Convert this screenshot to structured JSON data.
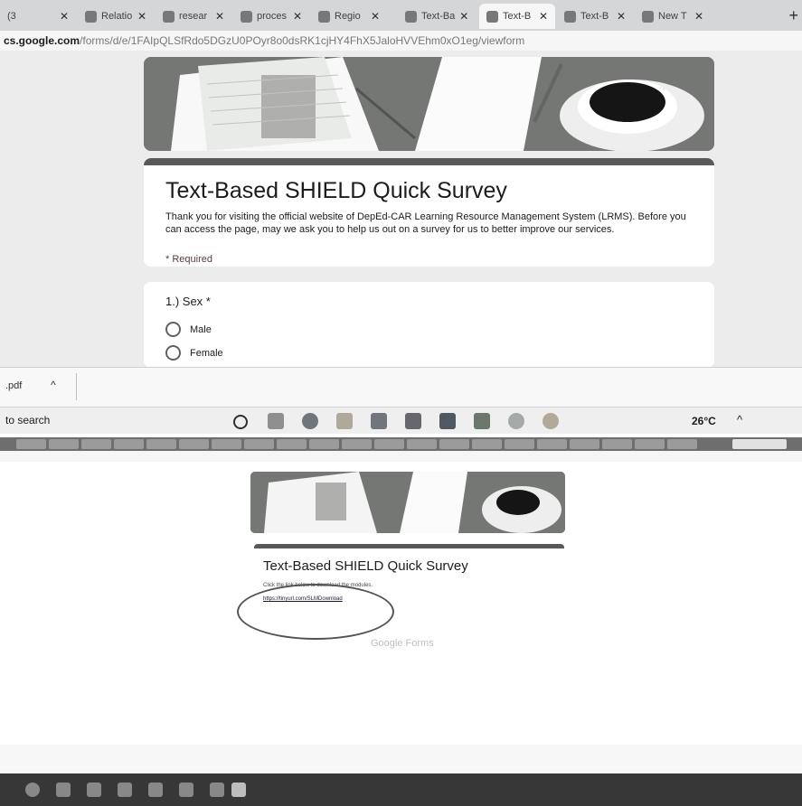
{
  "top": {
    "tabs": [
      {
        "label": "(3"
      },
      {
        "label": "Relatio"
      },
      {
        "label": "resear"
      },
      {
        "label": "proces"
      },
      {
        "label": "Regio"
      },
      {
        "label": "Text-Ba"
      },
      {
        "label": "Text-B"
      },
      {
        "label": "Text-B"
      },
      {
        "label": "New T"
      }
    ],
    "url_host": "cs.google.com",
    "url_path": "/forms/d/e/1FAIpQLSfRdo5DGzU0POyr8o0dsRK1cjHY4FhX5JaloHVVEhm0xO1eg/viewform",
    "form": {
      "title": "Text-Based SHIELD Quick Survey",
      "description": "Thank you for visiting the official website of DepEd-CAR Learning Resource Management System (LRMS). Before you can access the page, may we ask you to help us out on a survey for us to better improve our services.",
      "required_note": "* Required",
      "question": "1.) Sex *",
      "options": [
        "Male",
        "Female"
      ]
    },
    "download_file": ".pdf",
    "search_placeholder": "to search",
    "temperature": "26°C"
  },
  "bottom": {
    "form_title": "Text-Based SHIELD Quick Survey",
    "click_text": "Click the link below to download the modules.",
    "link_text": "https://tinyurl.com/SLMDownload",
    "footer_text": "Google Forms"
  },
  "colors": {
    "accent": "#5b5b5b",
    "required": "#c5221f",
    "link": "#1a0dab"
  }
}
